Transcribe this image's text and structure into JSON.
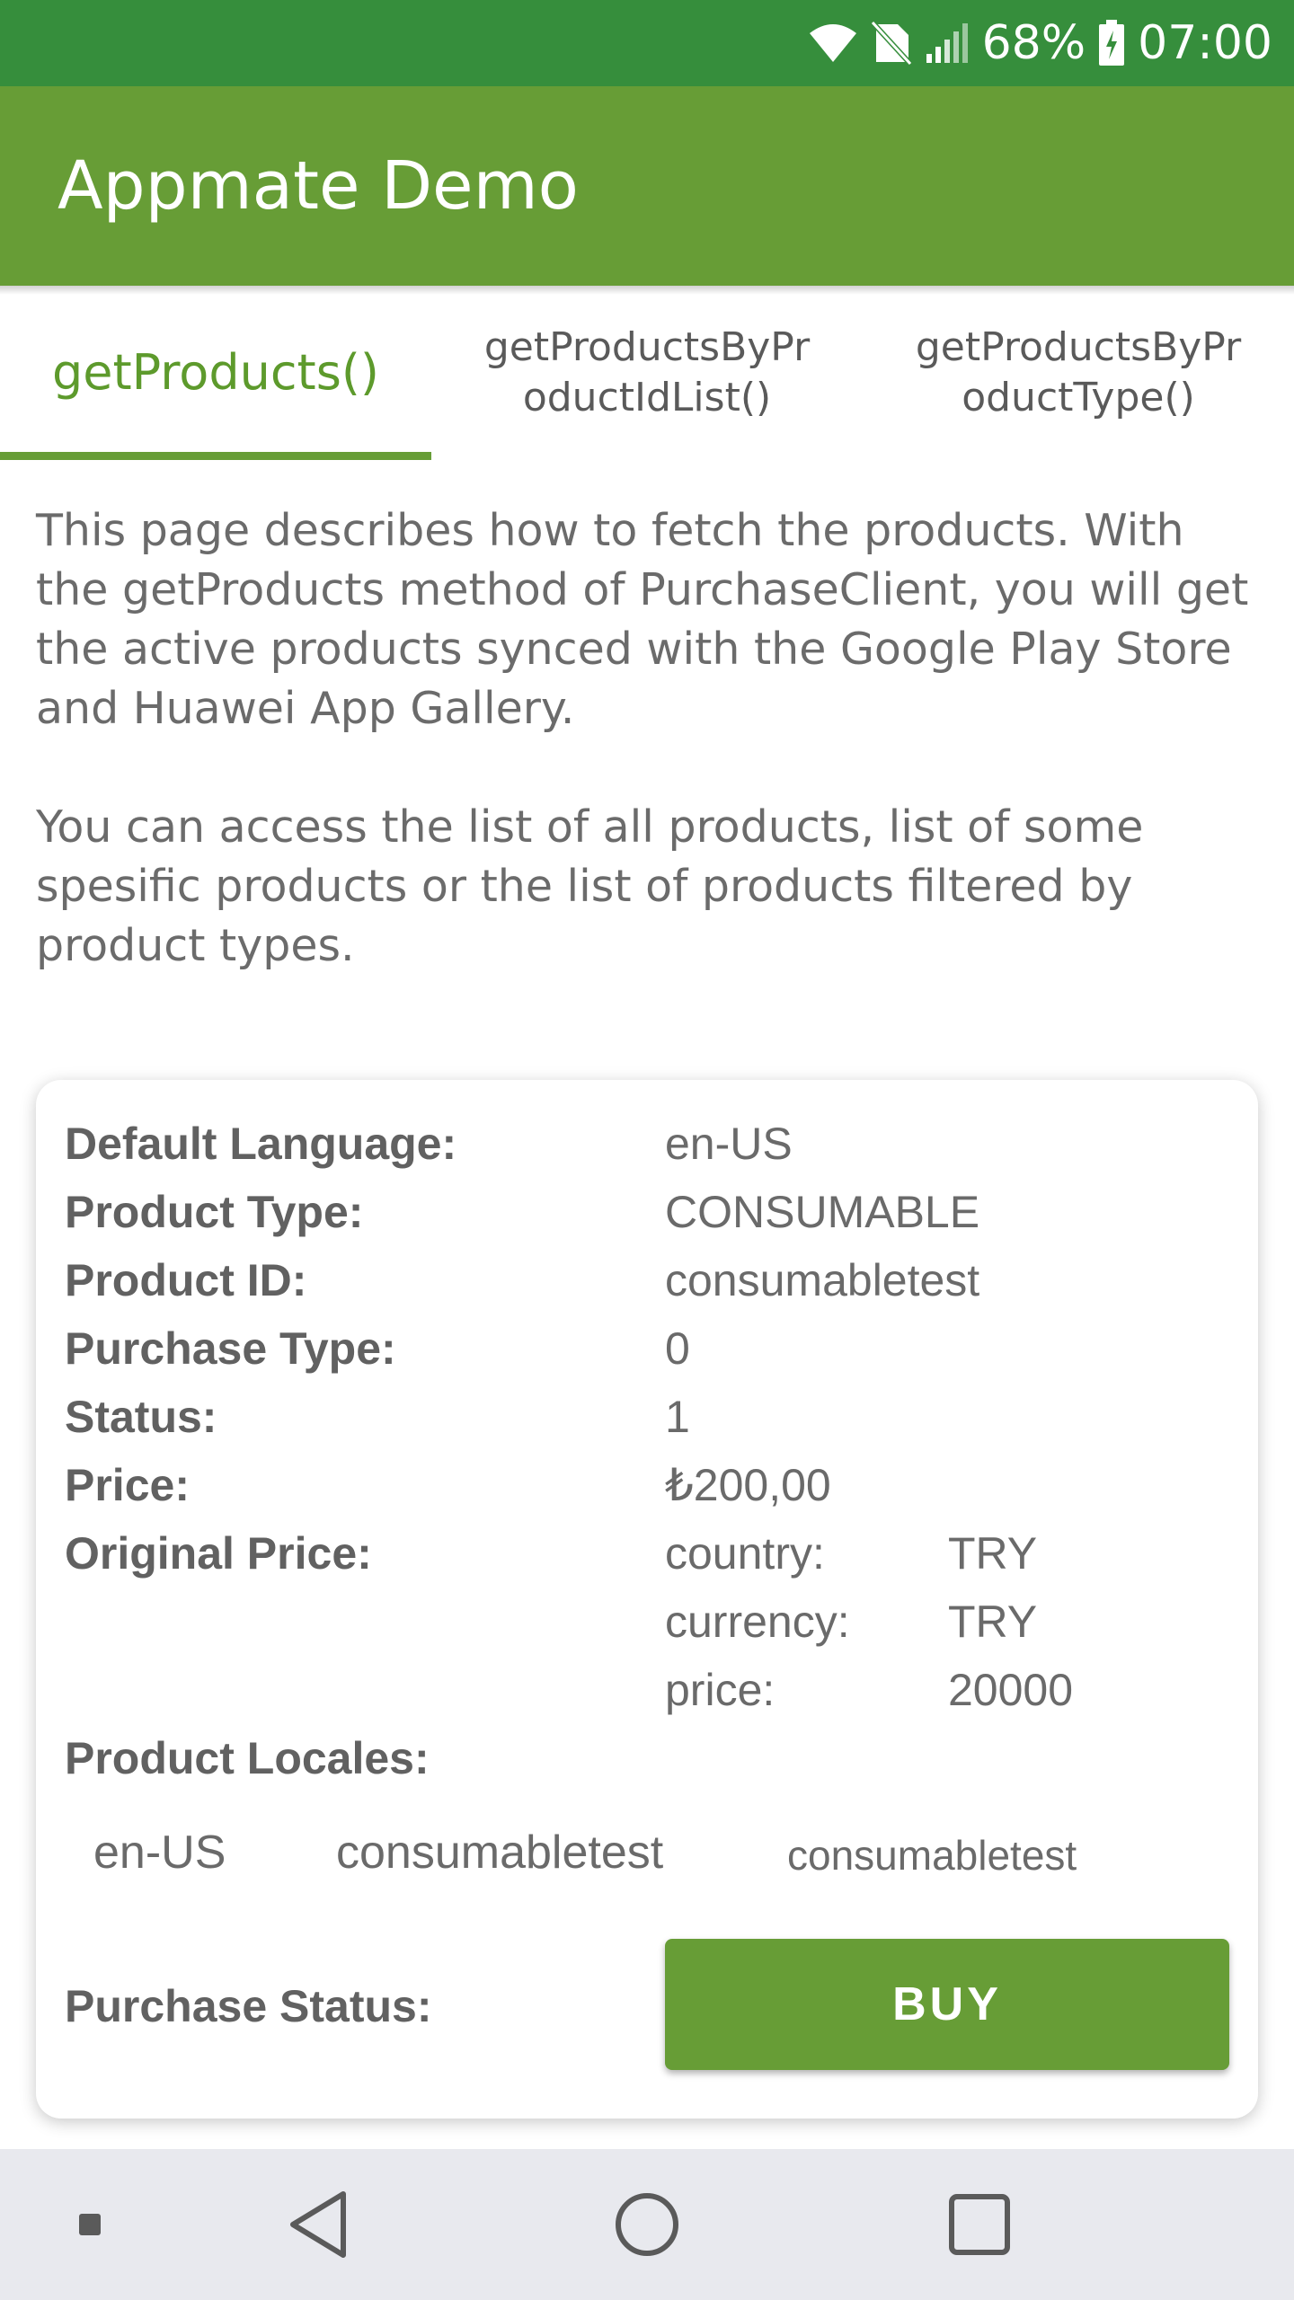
{
  "status_bar": {
    "battery": "68%",
    "time": "07:00",
    "icons": [
      "wifi-icon",
      "no-sim-icon",
      "signal-icon",
      "battery-icon"
    ]
  },
  "app_bar": {
    "title": "Appmate Demo",
    "color": "#679d36"
  },
  "tabs": [
    {
      "label": "getProducts()",
      "active": true
    },
    {
      "label": "getProductsByPr\noductIdList()",
      "active": false
    },
    {
      "label": "getProductsByPr\noductType()",
      "active": false
    }
  ],
  "description": {
    "p1": "This page describes how to fetch the products. With the getProducts method of PurchaseClient, you will get the active products synced with the Google Play Store and Huawei App Gallery.",
    "p2": "You can access the list of all products, list of some spesific products or the list of products filtered by product types."
  },
  "product": {
    "default_language_label": "Default Language:",
    "default_language": "en-US",
    "product_type_label": "Product Type:",
    "product_type": "CONSUMABLE",
    "product_id_label": "Product ID:",
    "product_id": "consumabletest",
    "purchase_type_label": "Purchase Type:",
    "purchase_type": "0",
    "status_label": "Status:",
    "status": "1",
    "price_label": "Price:",
    "price": "₺200,00",
    "original_price_label": "Original Price:",
    "original_price": {
      "country_label": "country:",
      "country": "TRY",
      "currency_label": "currency:",
      "currency": "TRY",
      "price_label": "price:",
      "price": "20000"
    },
    "locales_label": "Product Locales:",
    "locale": {
      "language": "en-US",
      "name": "consumabletest",
      "description": "consumabletest"
    },
    "purchase_status_label": "Purchase Status:",
    "buy_label": "BUY"
  },
  "nav_bar": {
    "icons": [
      "small-square-icon",
      "back-icon",
      "home-icon",
      "recents-icon"
    ]
  }
}
